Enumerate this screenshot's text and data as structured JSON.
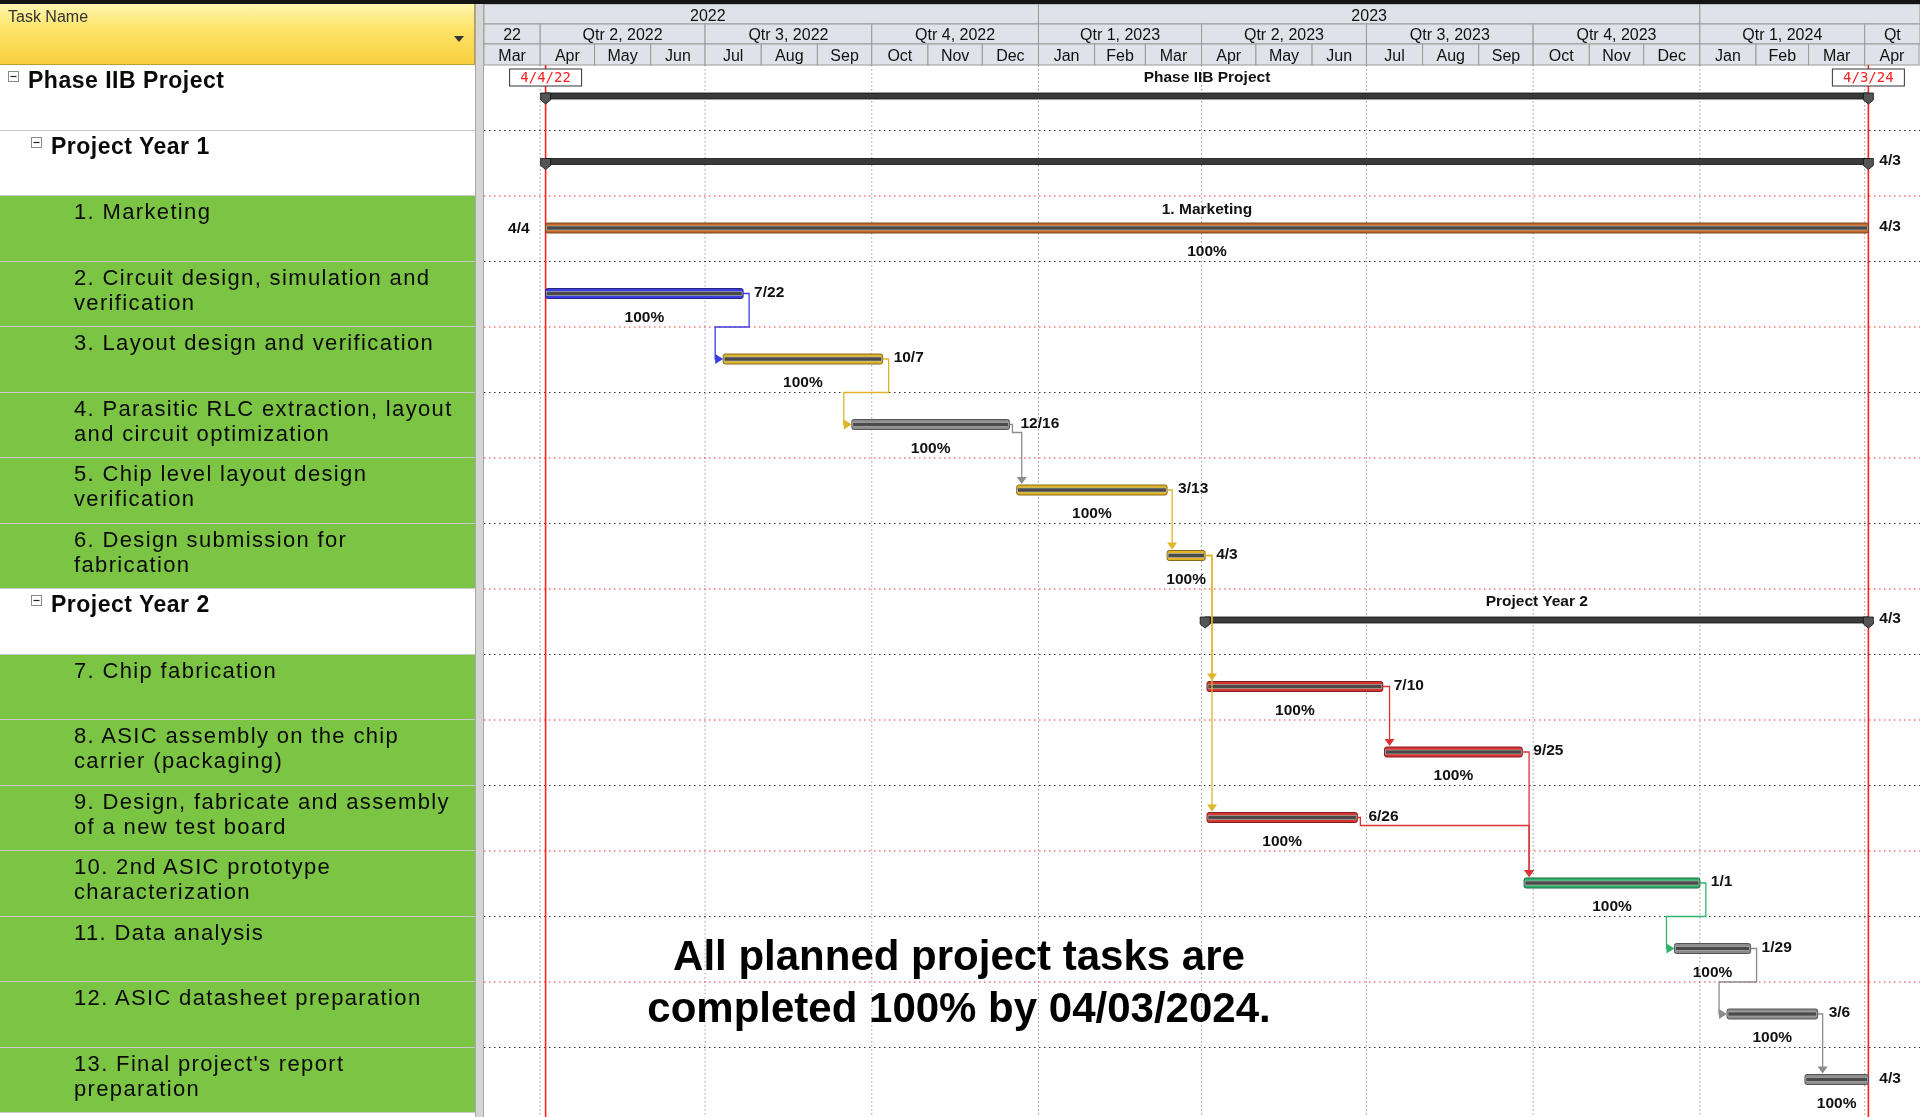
{
  "header": {
    "column_title": "Task Name"
  },
  "timescale": {
    "years": [
      "2022",
      "2023"
    ],
    "quarters": [
      "22",
      "Qtr 2, 2022",
      "Qtr 3, 2022",
      "Qtr 4, 2022",
      "Qtr 1, 2023",
      "Qtr 2, 2023",
      "Qtr 3, 2023",
      "Qtr 4, 2023",
      "Qtr 1, 2024",
      "Qt"
    ],
    "months": [
      "Mar",
      "Apr",
      "May",
      "Jun",
      "Jul",
      "Aug",
      "Sep",
      "Oct",
      "Nov",
      "Dec",
      "Jan",
      "Feb",
      "Mar",
      "Apr",
      "May",
      "Jun",
      "Jul",
      "Aug",
      "Sep",
      "Oct",
      "Nov",
      "Dec",
      "Jan",
      "Feb",
      "Mar",
      "Apr"
    ]
  },
  "markers": [
    {
      "label": "4/4/22"
    },
    {
      "label": "4/3/24"
    }
  ],
  "tasks": [
    {
      "name": "Phase IIB Project",
      "kind": "summary",
      "expanded": true,
      "bar": {
        "top_label": "Phase IIB Project"
      },
      "children": [
        {
          "name": "Project Year 1",
          "kind": "summary",
          "expanded": true,
          "bar": {
            "right_label": "4/3"
          },
          "children": [
            {
              "name": "1. Marketing",
              "kind": "task",
              "bar": {
                "color": "#c46a2a",
                "level": 1,
                "left_label": "4/4",
                "right_label": "4/3",
                "top_label": "1. Marketing",
                "bottom_label": "100%"
              }
            },
            {
              "name": "2. Circuit design, simulation and verification",
              "kind": "task",
              "bar": {
                "color": "#3c3ce0",
                "level": 1,
                "right_label": "7/22",
                "bottom_label": "100%"
              }
            },
            {
              "name": "3. Layout design and verification",
              "kind": "task",
              "bar": {
                "color": "#e0b428",
                "level": 1,
                "right_label": "10/7",
                "bottom_label": "100%"
              }
            },
            {
              "name": "4. Parasitic RLC extraction, layout and circuit optimization",
              "kind": "task",
              "bar": {
                "color": "#8c8c8c",
                "level": 1,
                "right_label": "12/16",
                "bottom_label": "100%"
              }
            },
            {
              "name": "5. Chip level layout design verification",
              "kind": "task",
              "bar": {
                "color": "#e0b428",
                "level": 1,
                "right_label": "3/13",
                "bottom_label": "100%"
              }
            },
            {
              "name": "6. Design submission for fabrication",
              "kind": "task",
              "bar": {
                "color": "#e0b428",
                "level": 1,
                "right_label": "4/3",
                "bottom_label": "100%"
              }
            }
          ]
        },
        {
          "name": "Project Year 2",
          "kind": "summary",
          "expanded": true,
          "bar": {
            "top_label": "Project Year 2",
            "right_label": "4/3"
          },
          "children": [
            {
              "name": "7. Chip fabrication",
              "kind": "task",
              "bar": {
                "color": "#d83434",
                "level": 1,
                "right_label": "7/10",
                "bottom_label": "100%"
              }
            },
            {
              "name": "8. ASIC assembly on the chip carrier (packaging)",
              "kind": "task",
              "bar": {
                "color": "#d83434",
                "level": 1,
                "right_label": "9/25",
                "bottom_label": "100%"
              }
            },
            {
              "name": "9. Design, fabricate and assembly of a new test board",
              "kind": "task",
              "bar": {
                "color": "#d83434",
                "level": 1,
                "right_label": "6/26",
                "bottom_label": "100%"
              }
            },
            {
              "name": "10. 2nd ASIC prototype characterization",
              "kind": "task",
              "bar": {
                "color": "#2eb36c",
                "level": 1,
                "right_label": "1/1",
                "bottom_label": "100%"
              }
            },
            {
              "name": "11. Data analysis",
              "kind": "task",
              "bar": {
                "color": "#8c8c8c",
                "level": 1,
                "right_label": "1/29",
                "bottom_label": "100%"
              }
            },
            {
              "name": "12. ASIC datasheet preparation",
              "kind": "task",
              "bar": {
                "color": "#8c8c8c",
                "level": 1,
                "right_label": "3/6",
                "bottom_label": "100%"
              }
            },
            {
              "name": "13. Final project's report preparation",
              "kind": "task",
              "bar": {
                "color": "#8c8c8c",
                "level": 1,
                "right_label": "4/3",
                "bottom_label": "100%"
              }
            }
          ]
        }
      ]
    }
  ],
  "note": "All planned project tasks are completed 100% by 04/03/2024."
}
